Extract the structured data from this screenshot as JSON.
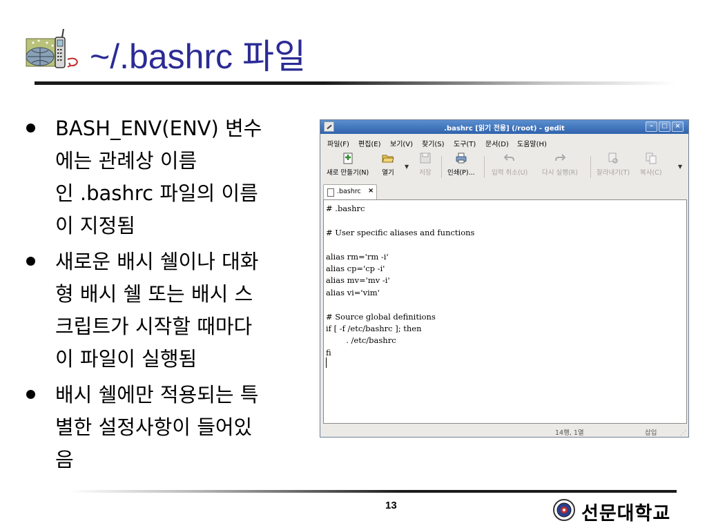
{
  "slide": {
    "title": "~/.bashrc 파일",
    "page_number": "13",
    "university": "선문대학교"
  },
  "bullets": [
    {
      "lines": [
        "BASH_ENV(ENV) 변수",
        "에는 관례상 이름",
        "인 .bashrc 파일의 이름",
        "이 지정됨"
      ]
    },
    {
      "lines": [
        "새로운 배시 쉘이나 대화",
        "형 배시 쉘 또는 배시 스",
        "크립트가 시작할 때마다",
        "이 파일이 실행됨"
      ]
    },
    {
      "lines": [
        "배시 쉘에만 적용되는 특",
        "별한 설정사항이 들어있",
        "음"
      ]
    }
  ],
  "gedit": {
    "window_title": ".bashrc [읽기 전용] (/root) - gedit",
    "window_buttons": {
      "minimize": "–",
      "maximize": "□",
      "close": "×"
    },
    "menu": [
      "파일(F)",
      "편집(E)",
      "보기(V)",
      "찾기(S)",
      "도구(T)",
      "문서(D)",
      "도움말(H)"
    ],
    "toolbar": [
      {
        "label": "새로 만들기(N)",
        "icon": "new-document-icon",
        "enabled": true
      },
      {
        "label": "열기",
        "icon": "open-folder-icon",
        "enabled": true
      },
      {
        "label": "저장",
        "icon": "save-icon",
        "enabled": false
      },
      {
        "label": "인쇄(P)...",
        "icon": "print-icon",
        "enabled": true
      },
      {
        "label": "입력 취소(U)",
        "icon": "undo-icon",
        "enabled": false
      },
      {
        "label": "다시 실행(R)",
        "icon": "redo-icon",
        "enabled": false
      },
      {
        "label": "잘라내기(T)",
        "icon": "cut-icon",
        "enabled": false
      },
      {
        "label": "복사(C)",
        "icon": "copy-icon",
        "enabled": false
      }
    ],
    "tab": {
      "label": ".bashrc",
      "close": "×"
    },
    "content": "# .bashrc\n\n# User specific aliases and functions\n\nalias rm='rm -i'\nalias cp='cp -i'\nalias mv='mv -i'\nalias vi='vim'\n\n# Source global definitions\nif [ -f /etc/bashrc ]; then\n        . /etc/bashrc\nfi\n",
    "status": {
      "position": "14행, 1열",
      "mode": "삽입"
    }
  }
}
